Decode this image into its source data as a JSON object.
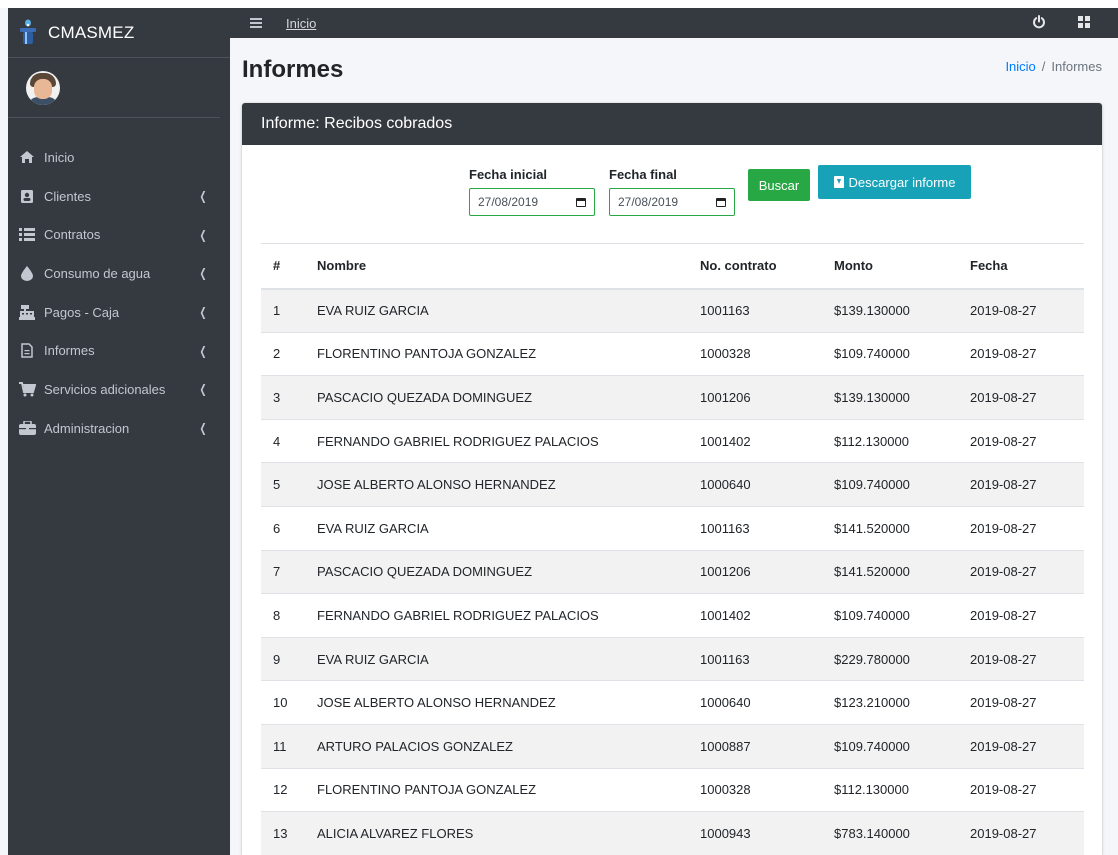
{
  "app": {
    "brand": "CMASMEZ"
  },
  "topbar": {
    "home_link": "Inicio"
  },
  "sidebar": {
    "items": [
      {
        "label": "Inicio",
        "icon": "home-icon",
        "has_submenu": false
      },
      {
        "label": "Clientes",
        "icon": "contact-card-icon",
        "has_submenu": true
      },
      {
        "label": "Contratos",
        "icon": "list-icon",
        "has_submenu": true
      },
      {
        "label": "Consumo de agua",
        "icon": "water-drop-icon",
        "has_submenu": true
      },
      {
        "label": "Pagos - Caja",
        "icon": "cash-register-icon",
        "has_submenu": true
      },
      {
        "label": "Informes",
        "icon": "file-icon",
        "has_submenu": true
      },
      {
        "label": "Servicios adicionales",
        "icon": "cart-icon",
        "has_submenu": true
      },
      {
        "label": "Administracion",
        "icon": "briefcase-icon",
        "has_submenu": true
      }
    ]
  },
  "page": {
    "title": "Informes",
    "breadcrumb": {
      "home": "Inicio",
      "separator": "/",
      "current": "Informes"
    }
  },
  "card": {
    "title": "Informe: Recibos cobrados",
    "filters": {
      "fecha_inicial_label": "Fecha inicial",
      "fecha_inicial_value": "27/08/2019",
      "fecha_final_label": "Fecha final",
      "fecha_final_value": "27/08/2019",
      "buscar_label": "Buscar",
      "descargar_label": "Descargar informe"
    },
    "table": {
      "headers": [
        "#",
        "Nombre",
        "No. contrato",
        "Monto",
        "Fecha"
      ],
      "rows": [
        [
          "1",
          "EVA RUIZ GARCIA",
          "1001163",
          "$139.130000",
          "2019-08-27"
        ],
        [
          "2",
          "FLORENTINO PANTOJA GONZALEZ",
          "1000328",
          "$109.740000",
          "2019-08-27"
        ],
        [
          "3",
          "PASCACIO QUEZADA DOMINGUEZ",
          "1001206",
          "$139.130000",
          "2019-08-27"
        ],
        [
          "4",
          "FERNANDO GABRIEL RODRIGUEZ PALACIOS",
          "1001402",
          "$112.130000",
          "2019-08-27"
        ],
        [
          "5",
          "JOSE ALBERTO ALONSO HERNANDEZ",
          "1000640",
          "$109.740000",
          "2019-08-27"
        ],
        [
          "6",
          "EVA RUIZ GARCIA",
          "1001163",
          "$141.520000",
          "2019-08-27"
        ],
        [
          "7",
          "PASCACIO QUEZADA DOMINGUEZ",
          "1001206",
          "$141.520000",
          "2019-08-27"
        ],
        [
          "8",
          "FERNANDO GABRIEL RODRIGUEZ PALACIOS",
          "1001402",
          "$109.740000",
          "2019-08-27"
        ],
        [
          "9",
          "EVA RUIZ GARCIA",
          "1001163",
          "$229.780000",
          "2019-08-27"
        ],
        [
          "10",
          "JOSE ALBERTO ALONSO HERNANDEZ",
          "1000640",
          "$123.210000",
          "2019-08-27"
        ],
        [
          "11",
          "ARTURO PALACIOS GONZALEZ",
          "1000887",
          "$109.740000",
          "2019-08-27"
        ],
        [
          "12",
          "FLORENTINO PANTOJA GONZALEZ",
          "1000328",
          "$112.130000",
          "2019-08-27"
        ],
        [
          "13",
          "ALICIA ALVAREZ FLORES",
          "1000943",
          "$783.140000",
          "2019-08-27"
        ]
      ]
    }
  },
  "colors": {
    "sidebar_bg": "#343a40",
    "success": "#28a745",
    "info": "#17a2b8",
    "link": "#007bff"
  }
}
